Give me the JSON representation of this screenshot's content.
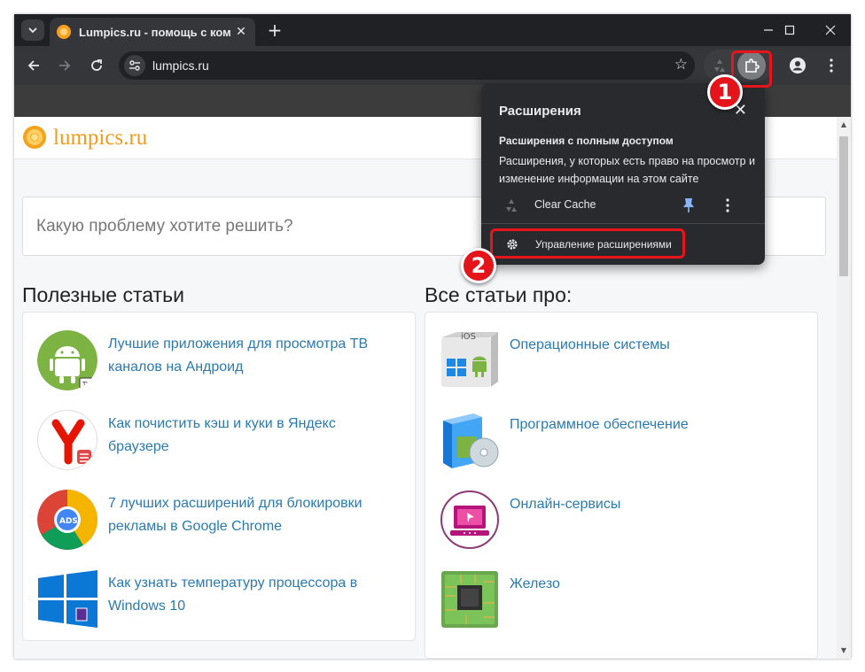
{
  "browser": {
    "tab_title": "Lumpics.ru - помощь с компь",
    "url": "lumpics.ru"
  },
  "site": {
    "logo_text": "lumpics.ru",
    "search_placeholder": "Какую проблему хотите решить?",
    "useful_articles_title": "Полезные статьи",
    "all_articles_title": "Все статьи про:",
    "articles": [
      {
        "title": "Лучшие приложения для просмотра ТВ каналов на Андроид",
        "icon": "android-tv-icon"
      },
      {
        "title": "Как почистить кэш и куки в Яндекс браузере",
        "icon": "yandex-browser-icon"
      },
      {
        "title": "7 лучших расширений для блокировки рекламы в Google Chrome",
        "icon": "chrome-adblock-icon"
      },
      {
        "title": "Как узнать температуру процессора в Windows 10",
        "icon": "windows-icon"
      }
    ],
    "categories": [
      {
        "title": "Операционные системы",
        "icon": "os-icon"
      },
      {
        "title": "Программное обеспечение",
        "icon": "software-icon"
      },
      {
        "title": "Онлайн-сервисы",
        "icon": "online-services-icon"
      },
      {
        "title": "Железо",
        "icon": "hardware-chip-icon"
      }
    ]
  },
  "extensions_popup": {
    "title": "Расширения",
    "subtitle": "Расширения с полным доступом",
    "description": "Расширения, у которых есть право на просмотр и изменение информации на этом сайте",
    "extension_name": "Clear Cache",
    "manage_label": "Управление расширениями"
  },
  "annotations": {
    "step1": "1",
    "step2": "2"
  },
  "colors": {
    "accent_red": "#e4141a",
    "link_blue": "#2a7ab0",
    "logo_orange": "#f29a1a",
    "pin_blue": "#8ab4f8"
  }
}
